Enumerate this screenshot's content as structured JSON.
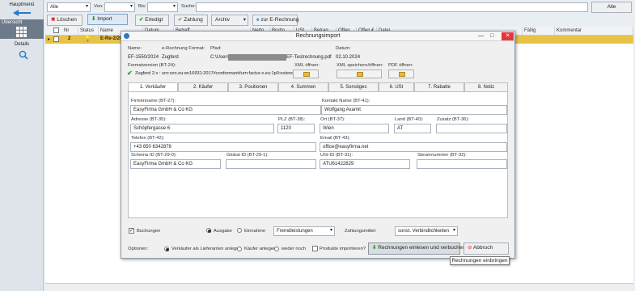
{
  "sidebar": {
    "main_menu": "Hauptmenü",
    "overview": "Übersicht",
    "details": "Details"
  },
  "filter": {
    "status_value": "Alle",
    "from_label": "Von:",
    "to_label": "Bis:",
    "search_label": "Suche:",
    "all_button": "Alle"
  },
  "toolbar": {
    "delete": "Löschen",
    "import": "Import",
    "done": "Erledigt",
    "payment": "Zahlung",
    "archive": "Archiv",
    "e_invoice": "zur E-Rechnung"
  },
  "grid": {
    "columns": [
      "Nr",
      "Status",
      "Name",
      "Datum",
      "Betreff",
      "Netto",
      "Brutto",
      "USt",
      "Betrag",
      "Offen",
      "Offen €",
      "Datei",
      "Fällig",
      "Kommentar"
    ],
    "row": {
      "nr": "2",
      "name": "E-Re-2/20"
    }
  },
  "dialog": {
    "title": "Rechnungsimport",
    "name_label": "Name:",
    "name_value": "EF-1550/2024",
    "format_label": "e-Rechnung Format:",
    "format_value": "Zugferd",
    "path_label": "Pfad:",
    "path_prefix": "C:\\Users\\",
    "path_suffix": "EF-Testrechnung.pdf",
    "date_label": "Datum:",
    "date_value": "02.10.2024",
    "formatversion_label": "Formatversion (BT-24):",
    "formatversion_value": "Zugferd 2.x : urn:cen.eu:en16931:2017#conformant#urn:factur-x.eu:1p0:extended",
    "xml_open": "XML öffnen:",
    "xml_save": "XML speichern/öffnen:",
    "pdf_open": "PDF öffnen:",
    "tabs": [
      "1. Verkäufer",
      "2. Käufer",
      "3. Positionen",
      "4. Summen",
      "5. Sonstiges",
      "6. USt",
      "7. Rabatte",
      "8. Notiz"
    ],
    "fields": {
      "company_label": "Firmenname (BT-27):",
      "company_value": "EasyFirma GmbH & Co KG",
      "contact_label": "Kontakt Name (BT-41):",
      "contact_value": "Wolfgang Axamit",
      "address_label": "Adresse (BT-35):",
      "address_value": "Schöpfergasse 6",
      "zip_label": "PLZ (BT-38):",
      "zip_value": "1120",
      "city_label": "Ort (BT-37):",
      "city_value": "Wien",
      "country_label": "Land (BT-40):",
      "country_value": "AT",
      "extra_label": "Zusatz (BT-36):",
      "extra_value": "",
      "phone_label": "Telefon (BT-42):",
      "phone_value": "+43 650 6342878",
      "email_label": "Email (BT-43):",
      "email_value": "office@easyfirma.net",
      "schema_label": "Schema ID (BT-29-0):",
      "schema_value": "EasyFirma GmbH & Co KG",
      "global_label": "Global ID (BT-29-1):",
      "global_value": "",
      "vat_label": "USt-ID (BT-31):",
      "vat_value": "ATU61422829",
      "tax_label": "Steuernummer (BT-32):",
      "tax_value": ""
    },
    "bookings_label": "Buchungen",
    "out_label": "Ausgabe",
    "in_label": "Einnahme",
    "category_value": "Fremdleistungen",
    "payment_label": "Zahlungsmittel:",
    "payment_value": "sonst. Verbindlichkeiten",
    "options_label": "Optionen:",
    "opt_seller": "Verkäufer als Lieferanten anlegen",
    "opt_buyer": "Käufer anlegen",
    "opt_none": "weder noch",
    "opt_products": "Produkte importieren?",
    "import_button": "Rechnungen einlesen und verbuchen",
    "abort_button": "Abbruch",
    "tooltip": "Rechnungen einbringen"
  }
}
